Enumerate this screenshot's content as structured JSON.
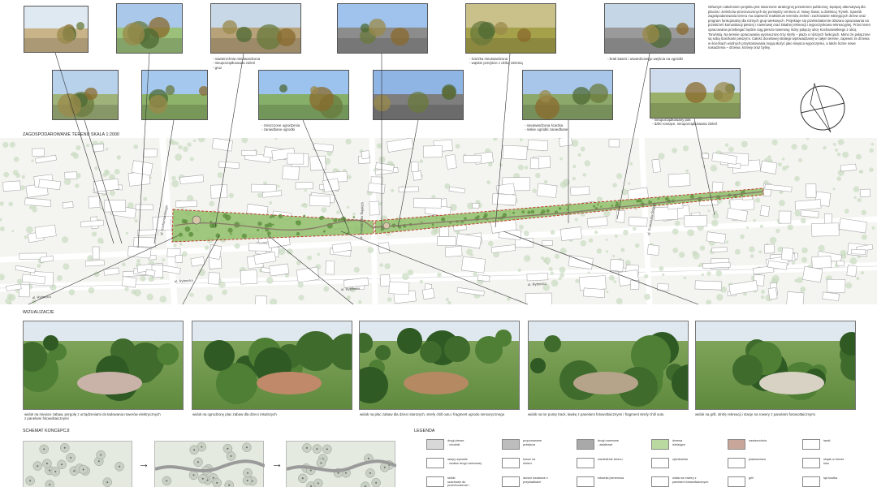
{
  "description": "Głównym założeniem projektu jest stworzenie atrakcyjnej przestrzeni publicznej, będącej alternatywą dla placów i zieleńców przeznaczonych się pomiędzy centrum ul. Nowy Świat, a dzielnicą Trynek. Sposób zagospodarowania terenu ma zapewnić maksimum terenów zieleni i zachowanie istniejących drzew oraz program funkcjonalny dla różnych grup wiekowych. Projektuje się przekształcenie obszaru opracowania na przestrzeń komunikacji pieszej i rowerowej oraz lokalnej rekreacji i wypoczynkowo-rekreacyjnej. Przez teren opracowania przebiegać będzie ciąg pieszo-rowerowy, który połączy ulicę Kochanowskiego z ulicą Toruńską. Na terenie opracowania wyznaczono trzy strefy – plaża o niższych funkcjach. Mimo że połączone są sobą ścieżkami pieszymi. Całość docelowej strategii wprowadzanej w całym terenie, zapewni że drzewa w ścieżkach wodnych przystosowania mogą służyć jako miejsca wypoczynku, a także liczne nowe nasadzenia – drzewa, krzewy oraz byliny.",
  "photo_captions": [
    "- nawierzchnia nieutwardzona\n- nieuporządkowana zieleń\n- gruz",
    "- zniszczone ogrodzenia\n- zaniedbane ogrodki",
    "- ścieżka nieutwardzona\n- wąskie przejście z dziką zielenią",
    "- nieutwardzona ścieżka\n- niskie ogródki zaniedbane",
    "- brak latarni i utwardzonego wejścia na ogródki",
    "- nieuporządkowany pas\n- dziki rosnące, nieuporządkowana zieleń"
  ],
  "map": {
    "title": "ZAGOSPODAROWANIE TERENU SKALA 1:2000",
    "street_labels": [
      "ul. Rybnicka",
      "ul. Rybnicka",
      "ul. Rybnicka",
      "ul. Rybnicka",
      "ul. Kochanowskiego",
      "ul. Powstańców Śląskich",
      "ul. Franciszka Ścigały"
    ]
  },
  "visualizations": {
    "title": "WIZUALIZACJE",
    "captions": [
      "widok na miejsce zabaw, pergolę z urządzeniami do ładowania rowerów elektrycznych\nz panelami fotowoltaicznymi",
      "widok na ogrodzony plac zabaw dla dzieci młodszych",
      "widok na plac zabaw dla dzieci starszych, strefę chill outu i fragment ogrodu sensorycznego",
      "widok na tor pump track, ławkę z panelami fotowoltaicznymi i fragment strefy chill outu",
      "widok na grill, strefę rekreacji i stacje na rowery z panelami fotowoltaicznymi"
    ]
  },
  "concept": {
    "title": "SCHEMAT KONCEPCJI",
    "arrow": "→"
  },
  "legend": {
    "title": "LEGENDA",
    "items": [
      {
        "label": "drogi piesze\n- chodnik",
        "color": "#d8d8d8"
      },
      {
        "label": "proponowane\nprzejścia",
        "color": "#bdbdbd"
      },
      {
        "label": "drogi rowerowe\n- asfaltowe",
        "color": "#a9a9a9"
      },
      {
        "label": "drzewa\nistniejące",
        "color": "#b9d9a0"
      },
      {
        "label": "nawierzchnia",
        "color": "#c8a79a"
      },
      {
        "label": "ławki",
        "color": "#ffffff"
      },
      {
        "label": "lampy wysokie\n- wzdłuż drogi rowerowej",
        "color": "#ffffff"
      },
      {
        "label": "kosze na\nśmieci",
        "color": "#ffffff"
      },
      {
        "label": "oświetlenie terenu",
        "color": "#ffffff"
      },
      {
        "label": "zjeżdżalnia",
        "color": "#ffffff"
      },
      {
        "label": "piaskownica",
        "color": "#ffffff"
      },
      {
        "label": "stojak w formie\nłuku",
        "color": "#ffffff"
      },
      {
        "label": "stoliki\nszachowe do\nprzechodzenia i\nsiedzenia",
        "color": "#ffffff"
      },
      {
        "label": "donice kwiatowe z\nprzysiadkami",
        "color": "#ffffff"
      },
      {
        "label": "siłownia plenerowa",
        "color": "#ffffff"
      },
      {
        "label": "wiata na rowery z\npanelami fotowoltaicznymi",
        "color": "#ffffff"
      },
      {
        "label": "grill",
        "color": "#ffffff"
      },
      {
        "label": "ląd kostka",
        "color": "#ffffff"
      }
    ]
  },
  "colors": {
    "plan_red": "#c0392b",
    "plan_green": "#8fbf6a",
    "map_bg": "#f4f4f1",
    "building": "#ffffff",
    "tree": "#c9dcc0"
  }
}
